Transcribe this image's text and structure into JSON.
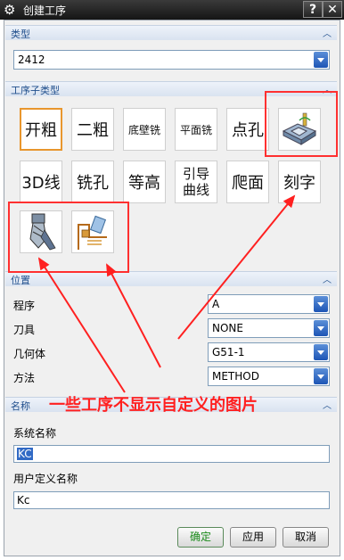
{
  "window": {
    "title": "创建工序",
    "help_label": "?",
    "close_label": "✕"
  },
  "type_section": {
    "header": "类型",
    "value": "2412"
  },
  "subtype_section": {
    "header": "工序子类型",
    "buttons": [
      "开粗",
      "二粗",
      "底壁铣",
      "平面铣",
      "点孔",
      "",
      "3D线",
      "铣孔",
      "等高",
      "引导\n曲线",
      "爬面",
      "刻字"
    ]
  },
  "location_section": {
    "header": "位置",
    "fields": [
      {
        "label": "程序",
        "value": "A"
      },
      {
        "label": "刀具",
        "value": "NONE"
      },
      {
        "label": "几何体",
        "value": "G51-1"
      },
      {
        "label": "方法",
        "value": "METHOD"
      }
    ]
  },
  "name_section": {
    "header": "名称",
    "system_name_label": "系统名称",
    "system_name_value": "KC",
    "user_name_label": "用户定义名称",
    "user_name_value": "Kc"
  },
  "annotation": "一些工序不显示自定义的图片",
  "buttons": {
    "ok": "确定",
    "apply": "应用",
    "cancel": "取消"
  },
  "colors": {
    "annotation_red": "#ff2020",
    "section_header": "#1f4e8c",
    "selected_border": "#e8962d",
    "ok_text": "#1a8a1a"
  }
}
